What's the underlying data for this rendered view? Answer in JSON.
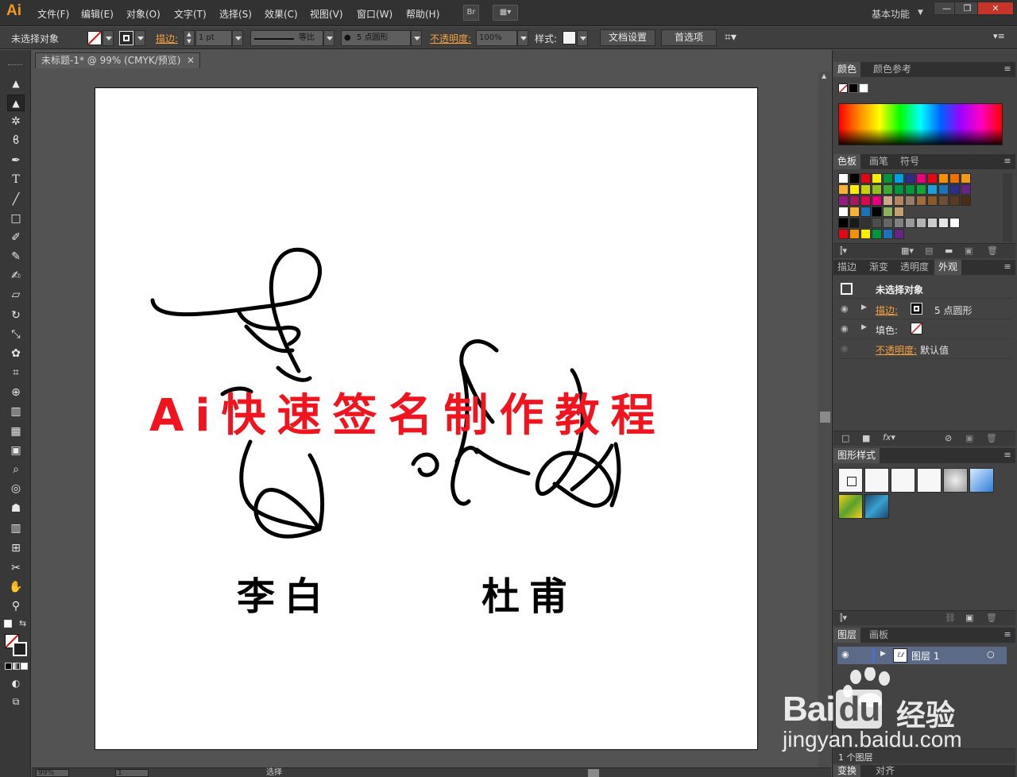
{
  "app": {
    "logo": "Ai",
    "workspace": "基本功能"
  },
  "menu": [
    "文件(F)",
    "编辑(E)",
    "对象(O)",
    "文字(T)",
    "选择(S)",
    "效果(C)",
    "视图(V)",
    "窗口(W)",
    "帮助(H)"
  ],
  "menubar_buttons": {
    "bridge": "Br"
  },
  "window_controls": {
    "minimize": "—",
    "restore": "❐",
    "close": "✕"
  },
  "controlbar": {
    "selection": "未选择对象",
    "stroke_label": "描边:",
    "stroke_weight": "1 pt",
    "profile": "等比",
    "brush": "5 点圆形",
    "opacity_label": "不透明度:",
    "opacity": "100%",
    "style_label": "样式:",
    "doc_setup": "文档设置",
    "prefs": "首选项"
  },
  "document": {
    "tab": "未标题-1* @ 99% (CMYK/预览)",
    "zoom": "99%",
    "page": "1",
    "status": "选择"
  },
  "artwork": {
    "headline": "Ai快速签名制作教程",
    "name_left": "李白",
    "name_right": "杜甫",
    "headline_color": "#f0141e"
  },
  "panels": {
    "color": {
      "tabs": [
        "颜色",
        "颜色参考"
      ]
    },
    "swatches": {
      "tabs": [
        "色板",
        "画笔",
        "符号"
      ]
    },
    "appearance": {
      "tabs": [
        "描边",
        "渐变",
        "透明度",
        "外观"
      ],
      "title": "未选择对象",
      "stroke_label": "描边:",
      "stroke_value": "5 点圆形",
      "fill_label": "填色:",
      "opacity_label": "不透明度:",
      "opacity_value": "默认值"
    },
    "graphic_styles": {
      "tabs": [
        "图形样式"
      ]
    },
    "layers": {
      "tabs": [
        "图层",
        "画板"
      ],
      "layer_name": "图层 1",
      "footer": "1 个图层"
    },
    "transform": {
      "tabs": [
        "变换",
        "对齐"
      ]
    }
  },
  "watermark": {
    "brand": "Bai",
    "brand2": "du",
    "cn": "经验",
    "url": "jingyan.baidu.com"
  },
  "swatch_colors": [
    [
      "#ffffff",
      "#000000",
      "#e30613",
      "#ffed00",
      "#009640",
      "#00a0e3",
      "#2d2e83",
      "#e6007e",
      "#e30613",
      "#f39200",
      "#ee7203",
      "#f39a1c"
    ],
    [
      "#f9b233",
      "#ffed00",
      "#c7d300",
      "#95c11f",
      "#3aaa35",
      "#009640",
      "#00963f",
      "#13a538",
      "#1d9fd9",
      "#1d71b8",
      "#2d2e83",
      "#662483"
    ],
    [
      "#951b81",
      "#a3195b",
      "#d60b52",
      "#e6007e",
      "#c9a98a",
      "#b18660",
      "#957d6a",
      "#a26b3b",
      "#8a5a2b",
      "#6f4e37",
      "#5b3a22",
      "#4b2d16"
    ],
    [
      "#ffffff",
      "#f9b233",
      "#1d71b8",
      "#000000",
      "#8bb35f",
      "#c4a070"
    ],
    [
      "#000000",
      "#1a1a1a",
      "#333333",
      "#4d4d4d",
      "#666666",
      "#808080",
      "#999999",
      "#b3b3b3",
      "#cccccc",
      "#e6e6e6",
      "#ffffff"
    ],
    [
      "#e30613",
      "#f39200",
      "#ffed00",
      "#009640",
      "#1d71b8",
      "#662483"
    ]
  ],
  "color_accents": {
    "orange_label": "#f7a03c",
    "panel_bg": "#434343",
    "layer_color": "#4f6bd8"
  },
  "icons": {
    "select": "▲",
    "direct": "▲",
    "wand": "✲",
    "lasso": "ϐ",
    "pen": "✒",
    "type": "T",
    "line": "╱",
    "rect": "□",
    "brush": "✐",
    "pencil": "✎",
    "blob": "✍",
    "eraser": "▱",
    "rotate": "↻",
    "scale": "⤡",
    "warp": "✿",
    "free": "⌗",
    "shape": "⊕",
    "mesh": "▦",
    "gradient": "▣",
    "eyedrop": "⌕",
    "blend": "◎",
    "symbol": "☗",
    "graph": "▥",
    "artboard": "⊞",
    "slice": "✂",
    "hand": "✋",
    "zoom": "⚲"
  }
}
